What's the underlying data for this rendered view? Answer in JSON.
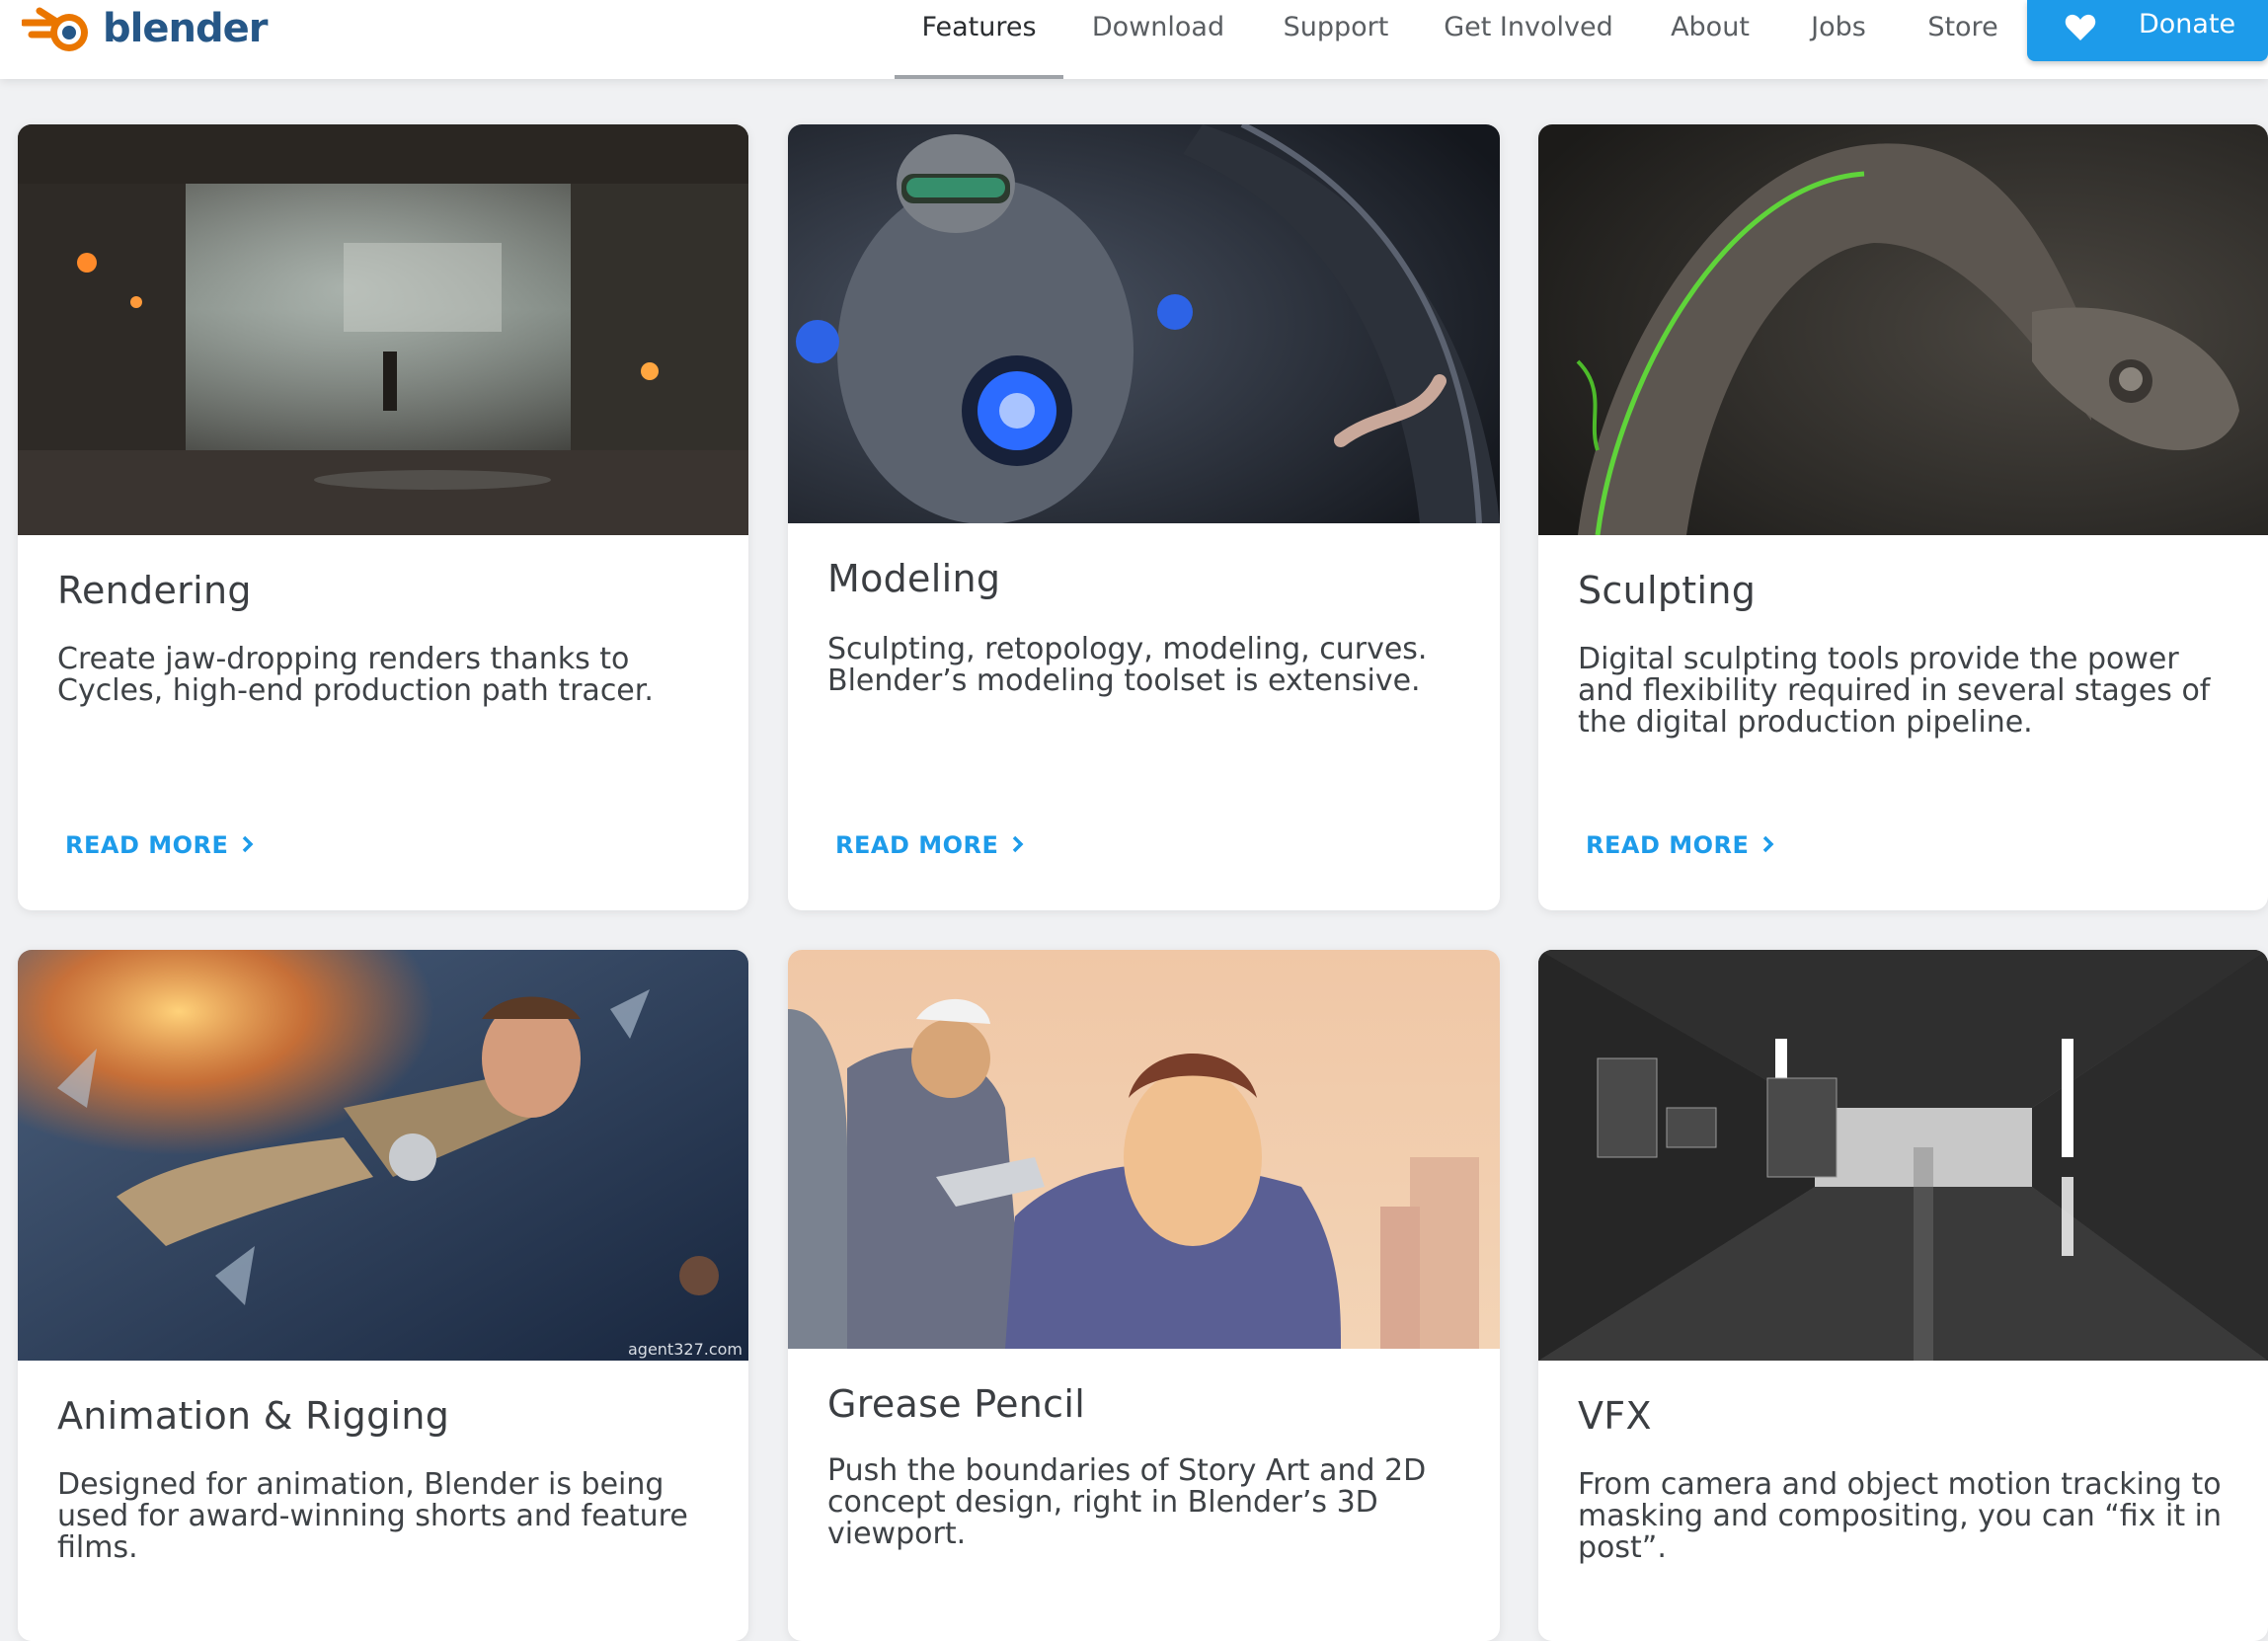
{
  "brand": {
    "logo_text": "blender",
    "logo_icon": "blender-logo-icon",
    "colors": {
      "orange": "#ea7600",
      "blue": "#265787",
      "accent": "#1d9bea"
    }
  },
  "nav": {
    "items": [
      {
        "label": "Features",
        "active": true
      },
      {
        "label": "Download"
      },
      {
        "label": "Support"
      },
      {
        "label": "Get Involved"
      },
      {
        "label": "About"
      },
      {
        "label": "Jobs"
      },
      {
        "label": "Store"
      }
    ],
    "donate": {
      "label": "Donate",
      "icon": "heart-icon"
    }
  },
  "cards": [
    {
      "title": "Rendering",
      "description": "Create jaw-dropping renders thanks to Cycles, high-end production path tracer.",
      "link": "READ MORE"
    },
    {
      "title": "Modeling",
      "description": "Sculpting, retopology, modeling, curves. Blender’s modeling toolset is extensive.",
      "link": "READ MORE"
    },
    {
      "title": "Sculpting",
      "description": "Digital sculpting tools provide the power and flexibility required in several stages of the digital production pipeline.",
      "link": "READ MORE"
    },
    {
      "title": "Animation & Rigging",
      "description": "Designed for animation, Blender is being used for award-winning shorts and feature films.",
      "image_credit": "agent327.com"
    },
    {
      "title": "Grease Pencil",
      "description": "Push the boundaries of Story Art and 2D concept design, right in Blender’s 3D viewport."
    },
    {
      "title": "VFX",
      "description": "From camera and object motion tracking to masking and compositing, you can “fix it in post”."
    }
  ]
}
